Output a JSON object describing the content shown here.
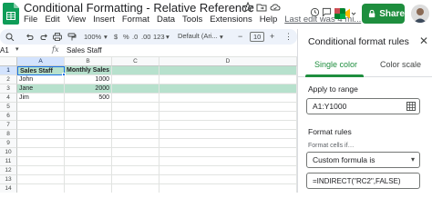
{
  "header": {
    "doc_title": "Conditional Formatting - Relative Reference",
    "menu": [
      "File",
      "Edit",
      "View",
      "Insert",
      "Format",
      "Data",
      "Tools",
      "Extensions",
      "Help"
    ],
    "last_edit": "Last edit was 4 mi...",
    "share_label": "Share"
  },
  "toolbar": {
    "zoom": "100%",
    "currency": "$",
    "percent": "%",
    "decrease_decimals": ".0",
    "increase_decimals": ".00",
    "number_format": "123",
    "font": "Default (Ari...",
    "font_size": "10"
  },
  "formula_bar": {
    "name_box": "A1",
    "fx": "fx",
    "content": "Sales Staff"
  },
  "grid": {
    "columns": [
      "A",
      "B",
      "C",
      "D"
    ],
    "rows": [
      "1",
      "2",
      "3",
      "4",
      "5",
      "6",
      "7",
      "8",
      "9",
      "10",
      "11",
      "12",
      "13",
      "14"
    ],
    "cells": {
      "A1": "Sales Staff",
      "B1": "Monthly Sales",
      "A2": "John",
      "B2": "1000",
      "A3": "Jane",
      "B3": "2000",
      "A4": "Jim",
      "B4": "500"
    }
  },
  "panel": {
    "title": "Conditional format rules",
    "tab_single": "Single color",
    "tab_scale": "Color scale",
    "apply_label": "Apply to range",
    "range_value": "A1:Y1000",
    "rules_label": "Format rules",
    "cells_if": "Format cells if…",
    "condition": "Custom formula is",
    "formula": "=INDIRECT(\"RC2\",FALSE)"
  },
  "colors": {
    "highlight": "#b7e1cd",
    "share": "#1e8e3e",
    "selection": "#1a73e8"
  }
}
